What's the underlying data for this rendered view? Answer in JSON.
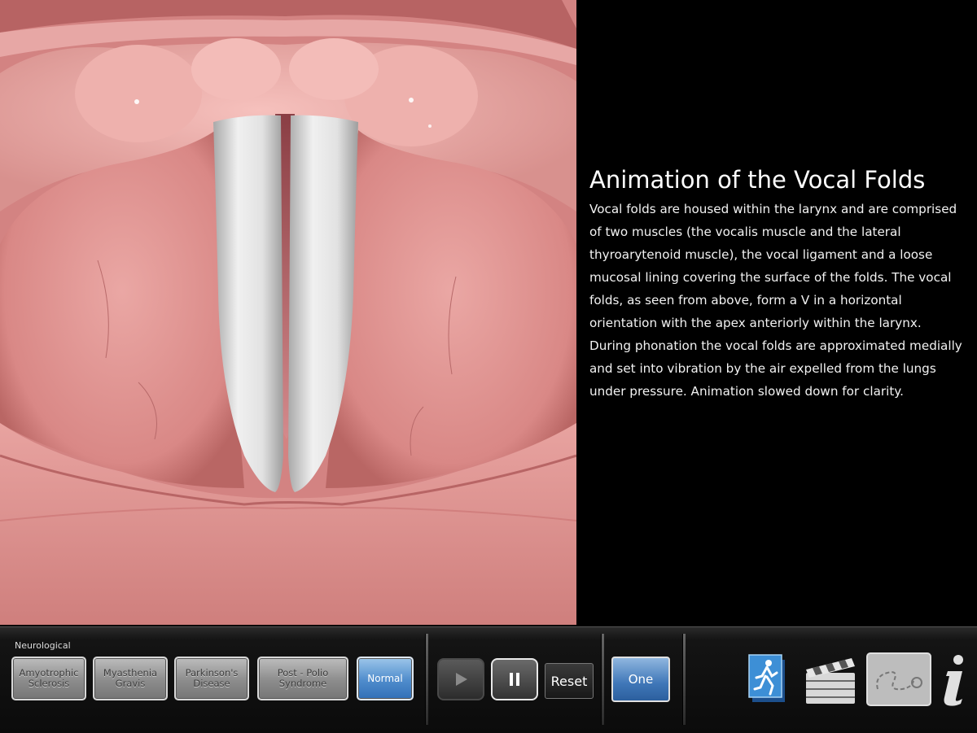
{
  "info": {
    "title": "Animation of the Vocal Folds",
    "body": "Vocal folds are housed within the larynx and are comprised of two muscles (the vocalis muscle and the lateral thyroarytenoid muscle), the vocal ligament and a loose mucosal lining covering the surface of the folds. The vocal folds, as seen from above, form a V in a horizontal orientation with the apex anteriorly within the larynx. During phonation the vocal folds are approximated medially and set into vibration by the air expelled from the lungs under pressure. Animation slowed down for clarity."
  },
  "toolbar": {
    "group_label": "Neurological",
    "conditions": [
      {
        "label": "Amyotrophic Sclerosis"
      },
      {
        "label": "Myasthenia Gravis"
      },
      {
        "label": "Parkinson's Disease"
      },
      {
        "label": "Post - Polio Syndrome"
      },
      {
        "label": "Normal",
        "selected": true
      }
    ],
    "playback": {
      "play_icon": "play-icon",
      "pause_icon": "pause-icon",
      "reset_label": "Reset"
    },
    "view_label": "One",
    "tools": [
      {
        "icon": "runner-icon"
      },
      {
        "icon": "clapperboard-icon"
      },
      {
        "icon": "drawing-icon"
      },
      {
        "icon": "info-icon"
      }
    ]
  },
  "colors": {
    "tissue": "#d98a8a",
    "tissue_dark": "#b86565",
    "fold_white": "#e6e6e6",
    "selected_blue": "#4f8ccc",
    "background": "#000000"
  }
}
